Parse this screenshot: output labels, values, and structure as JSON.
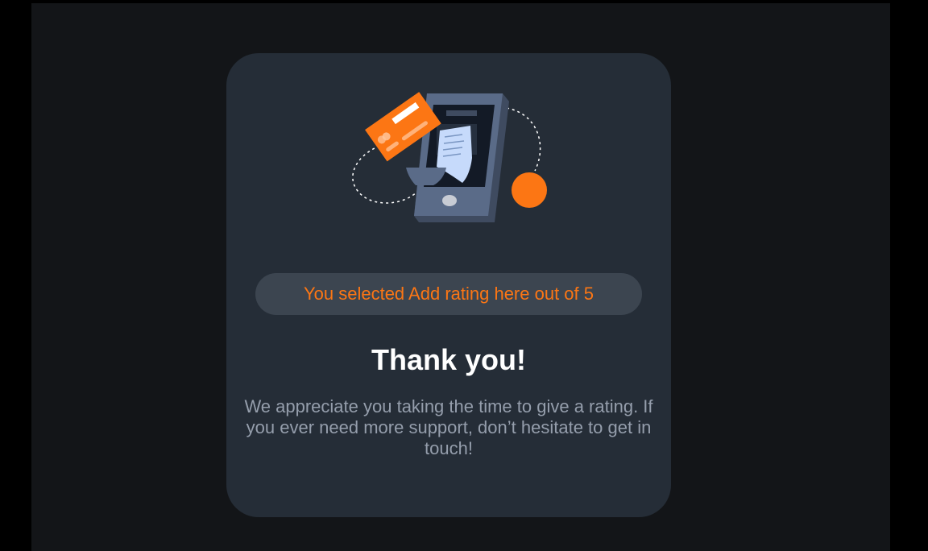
{
  "page": {
    "background_color": "#000000",
    "app_background_color": "#131518"
  },
  "card": {
    "background_color": "#252d37",
    "illustration_icon": "phone-receipt-card-illustration",
    "selection_text": "You selected Add rating here out of 5",
    "title": "Thank you!",
    "message": "We appreciate you taking the time to give a rating. If you ever need more support, don’t hesitate to get in touch!"
  },
  "colors": {
    "accent_orange": "#fc7614",
    "pill_background": "#3c4550",
    "muted_text": "#959eac",
    "heading_text": "#ffffff"
  }
}
